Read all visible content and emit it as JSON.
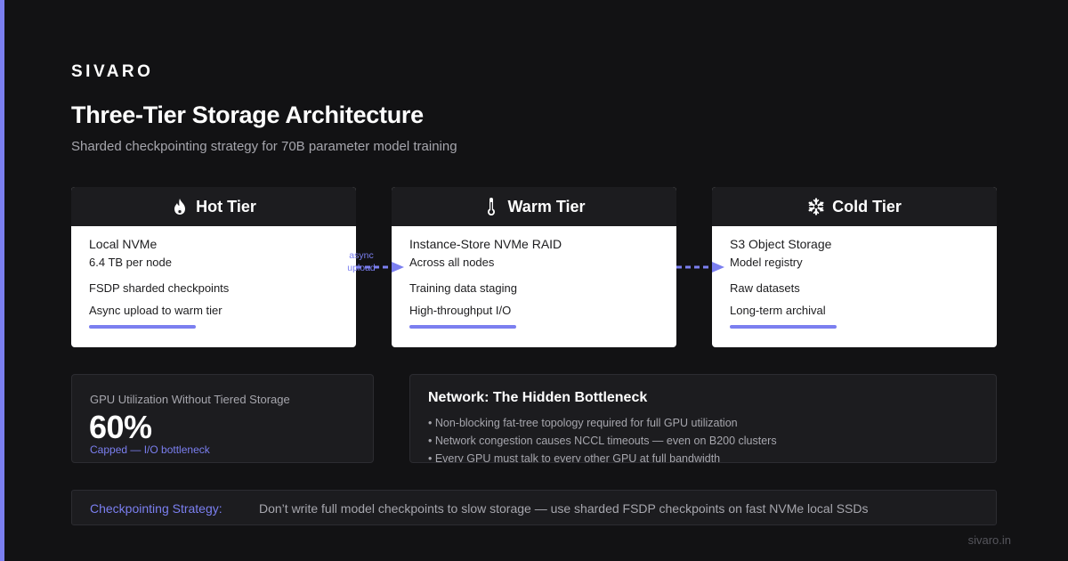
{
  "brand": "SIVARO",
  "title": "Three-Tier Storage Architecture",
  "subtitle": "Sharded checkpointing strategy for 70B parameter model training",
  "tiers": [
    {
      "name": "Hot Tier",
      "icon": "flame-icon",
      "storage": "Local NVMe",
      "lines": [
        "6.4 TB per node",
        "FSDP sharded checkpoints",
        "Async upload to warm tier"
      ]
    },
    {
      "name": "Warm Tier",
      "icon": "thermometer-icon",
      "storage": "Instance-Store NVMe RAID",
      "lines": [
        "Across all nodes",
        "Training data staging",
        "High-throughput I/O"
      ]
    },
    {
      "name": "Cold Tier",
      "icon": "snowflake-icon",
      "storage": "S3 Object Storage",
      "lines": [
        "Model registry",
        "Raw datasets",
        "Long-term archival"
      ]
    }
  ],
  "arrow_label_line1": "async",
  "arrow_label_line2": "upload",
  "stat": {
    "label": "GPU Utilization Without Tiered Storage",
    "value": "60%",
    "note": "Capped — I/O bottleneck"
  },
  "network": {
    "title": "Network: The Hidden Bottleneck",
    "items": [
      "• Non-blocking fat-tree topology required for full GPU utilization",
      "• Network congestion causes NCCL timeouts — even on B200 clusters",
      "• Every GPU must talk to every other GPU at full bandwidth"
    ]
  },
  "strategy": {
    "label": "Checkpointing Strategy:",
    "text": "Don’t write full model checkpoints to slow storage — use sharded FSDP checkpoints on fast NVMe local SSDs"
  },
  "footer_url": "sivaro.in",
  "colors": {
    "accent": "#7b7ff0",
    "background": "#121214",
    "card_dark": "#1c1c1f",
    "card_light": "#ffffff",
    "muted_text": "#a6a6ad"
  }
}
